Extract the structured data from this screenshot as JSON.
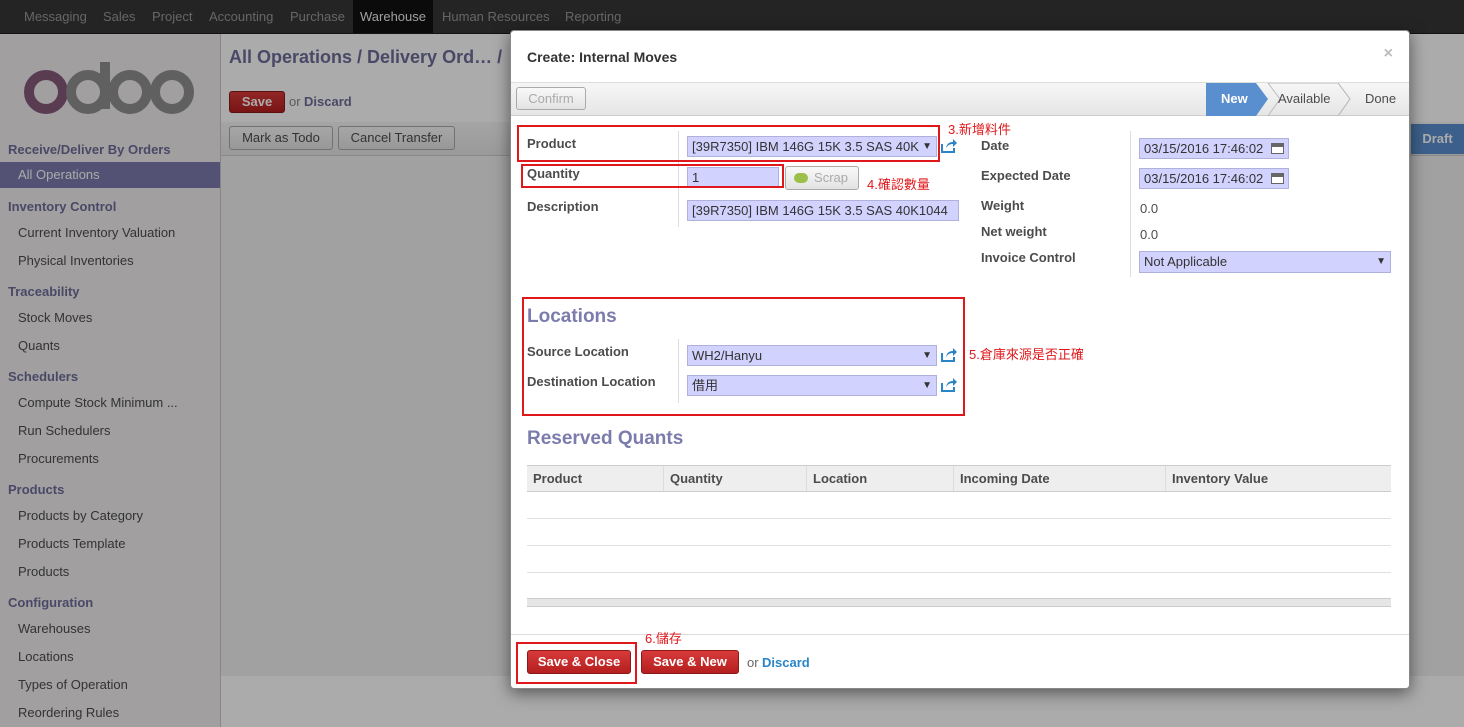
{
  "topnav": [
    "Messaging",
    "Sales",
    "Project",
    "Accounting",
    "Purchase",
    "Warehouse",
    "Human Resources",
    "Reporting"
  ],
  "topnav_active": "Warehouse",
  "logo_text": "odoo",
  "sidebar": {
    "sections": [
      {
        "title": "Receive/Deliver By Orders",
        "items": [
          "All Operations"
        ]
      },
      {
        "title": "Inventory Control",
        "items": [
          "Current Inventory Valuation",
          "Physical Inventories"
        ]
      },
      {
        "title": "Traceability",
        "items": [
          "Stock Moves",
          "Quants"
        ]
      },
      {
        "title": "Schedulers",
        "items": [
          "Compute Stock Minimum ...",
          "Run Schedulers",
          "Procurements"
        ]
      },
      {
        "title": "Products",
        "items": [
          "Products by Category",
          "Products Template",
          "Products"
        ]
      },
      {
        "title": "Configuration",
        "items": [
          "Warehouses",
          "Locations",
          "Types of Operation",
          "Reordering Rules"
        ]
      }
    ],
    "active": "All Operations"
  },
  "main": {
    "breadcrumb": "All Operations / Delivery Ord… / ",
    "save": "Save",
    "or": "or",
    "discard": "Discard",
    "mark_todo": "Mark as Todo",
    "cancel_transfer": "Cancel Transfer",
    "draft": "Draft"
  },
  "modal": {
    "title": "Create: Internal Moves",
    "close": "×",
    "confirm": "Confirm",
    "statuses": [
      "New",
      "Available",
      "Done"
    ],
    "status_active": "New",
    "product_label": "Product",
    "product_value": "[39R7350] IBM 146G 15K 3.5 SAS 40K",
    "quantity_label": "Quantity",
    "quantity_value": "1",
    "scrap": "Scrap",
    "description_label": "Description",
    "description_value": "[39R7350] IBM 146G 15K 3.5 SAS 40K1044",
    "date_label": "Date",
    "date_value": "03/15/2016 17:46:02",
    "expected_label": "Expected Date",
    "expected_value": "03/15/2016 17:46:02",
    "weight_label": "Weight",
    "weight_value": "0.0",
    "net_weight_label": "Net weight",
    "net_weight_value": "0.0",
    "invoice_label": "Invoice Control",
    "invoice_value": "Not Applicable",
    "locations_title": "Locations",
    "source_label": "Source Location",
    "source_value": "WH2/Hanyu",
    "dest_label": "Destination Location",
    "dest_value": "借用",
    "reserved_title": "Reserved Quants",
    "columns": [
      "Product",
      "Quantity",
      "Location",
      "Incoming Date",
      "Inventory Value"
    ],
    "save_close": "Save & Close",
    "save_new": "Save & New",
    "or": "or",
    "discard": "Discard"
  },
  "annotations": {
    "a3": "3.新增料件",
    "a4": "4.確認數量",
    "a5": "5.倉庫來源是否正確",
    "a6": "6.儲存"
  },
  "colors": {
    "accent": "#7c7bad",
    "danger": "#c32a2a",
    "annotation": "#e0181b",
    "link": "#2a85c7"
  }
}
